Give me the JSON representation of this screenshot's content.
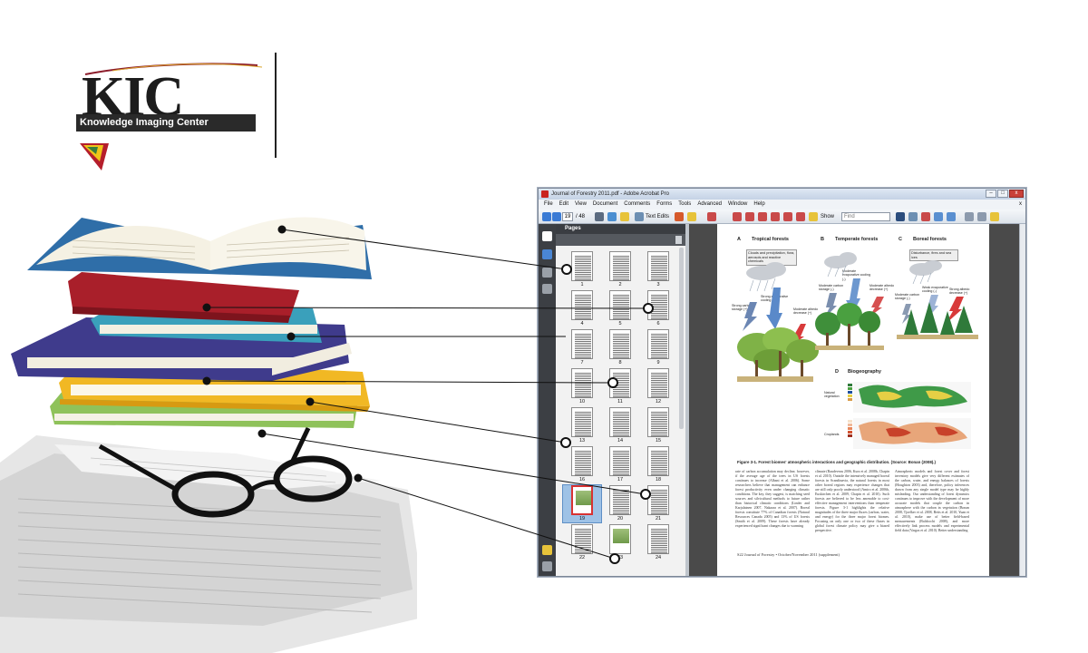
{
  "logo": {
    "word": "KIC",
    "subtitle": "Knowledge Imaging Center"
  },
  "window": {
    "title": "Journal of Forestry 2011.pdf - Adobe Acrobat Pro",
    "buttons": {
      "minimize": "–",
      "maximize": "□",
      "close": "x"
    }
  },
  "menu": {
    "items": [
      "File",
      "Edit",
      "View",
      "Document",
      "Comments",
      "Forms",
      "Tools",
      "Advanced",
      "Window",
      "Help"
    ],
    "close_glyph": "x"
  },
  "toolbar": {
    "current_page": "19",
    "page_count": "/ 48",
    "text_edits_label": "Text Edits",
    "show_label": "Show",
    "find_placeholder": "Find"
  },
  "pages_panel": {
    "title": "Pages",
    "thumbnails": [
      "1",
      "2",
      "3",
      "4",
      "5",
      "6",
      "7",
      "8",
      "9",
      "10",
      "11",
      "12",
      "13",
      "14",
      "15",
      "16",
      "17",
      "18",
      "19",
      "20",
      "21",
      "22",
      "23",
      "24"
    ],
    "selected": "19"
  },
  "document": {
    "panel_a_letter": "A",
    "panel_a_title": "Tropical forests",
    "panel_b_letter": "B",
    "panel_b_title": "Temperate forests",
    "panel_c_letter": "C",
    "panel_c_title": "Boreal forests",
    "panel_d_letter": "D",
    "panel_d_title": "Biogeography",
    "callout_a": "Clouds and precipitation, flora, aerosols and reactive chemicals",
    "callout_c": "Disturbance, fires and sea ices",
    "label_strong_carbon": "Strong carbon storage (+)",
    "label_strong_evap": "Strong evaporative cooling (-)",
    "label_moderate_albedo": "Moderate albedo decrease (+)",
    "label_moderate_carbon": "Moderate carbon storage (-)",
    "label_moderate_evap": "Moderate evaporative cooling (-)",
    "label_moderate_albedo_b": "Moderate albedo decrease (+)",
    "label_moderate_carbon_c": "Moderate carbon storage (-)",
    "label_weak_evap": "Weak evaporative cooling (-)",
    "label_strong_albedo": "Strong albedo decrease (+)",
    "legend_natural": "Natural vegetation",
    "legend_croplands": "Croplands",
    "caption": "Figure 3-1. Forest biomes' atmospheric interactions and geographic distribution. (Source: Bonan (2008).)",
    "col1": "rate of carbon accumulation may decline, however, if the average age of the trees in US forests continues to increase (Albani et al. 2006). Some researchers believe that management can enhance forest productivity even under changing climatic conditions. The key, they suggest, is matching seed sources and silvicultural methods to future rather than historical climatic conditions (Linder and Karjalainen 2007, Nakaara et al. 2007). Boreal forests constitute 77% of Canadian forests (Natural Resources Canada 2005) and 13% of US forests (Smith et al. 2009). These forests have already experienced significant changes due to warming",
    "col2": "climate (Raudeveau 2006, Kurz et al. 2008b, Chapin et al. 2010). Outside the intensively managed boreal forests in Scandinavia, the natural forests in most other boreal regions may experience changes that are still only poorly understood (Amiro et al. 2006b, Euskirchen et al. 2009, Chapin et al. 2010). Such forests are believed to be less amenable to cost-effective management interventions than temperate forests. Figure 3-1 highlights the relative magnitudes of the three major fluxes (carbon, water, and energy) for the three major forest biomes. Focusing on only one or two of these fluxes in global forest climate policy may give a biased perspective.",
    "col3": "Atmospheric models and forest cover and forest inventory models give very different estimates of the carbon, water, and energy balances of forests (Houghton 2003) and, therefore, policy inferences drawn from any single model type may be highly misleading. Our understanding of forest dynamics continues to improve with the development of more accurate models that couple the carbon in atmosphere with the carbon in vegetation (Bonan 2008, Tjoelker et al. 2008, Betts et al. 2010, Yuan et al. 2010), make use of better field-based measurements (Baldocchi 2008), and more effectively link process models and experimental field data (Vargas et al. 2010). Better understanding",
    "footer": "S22   Journal of Forestry • October/November 2011 (supplement)"
  },
  "colors": {
    "acrobat_red": "#c9231f",
    "selection_blue": "#9ec2e6",
    "nav_dark": "#3c3f44"
  }
}
